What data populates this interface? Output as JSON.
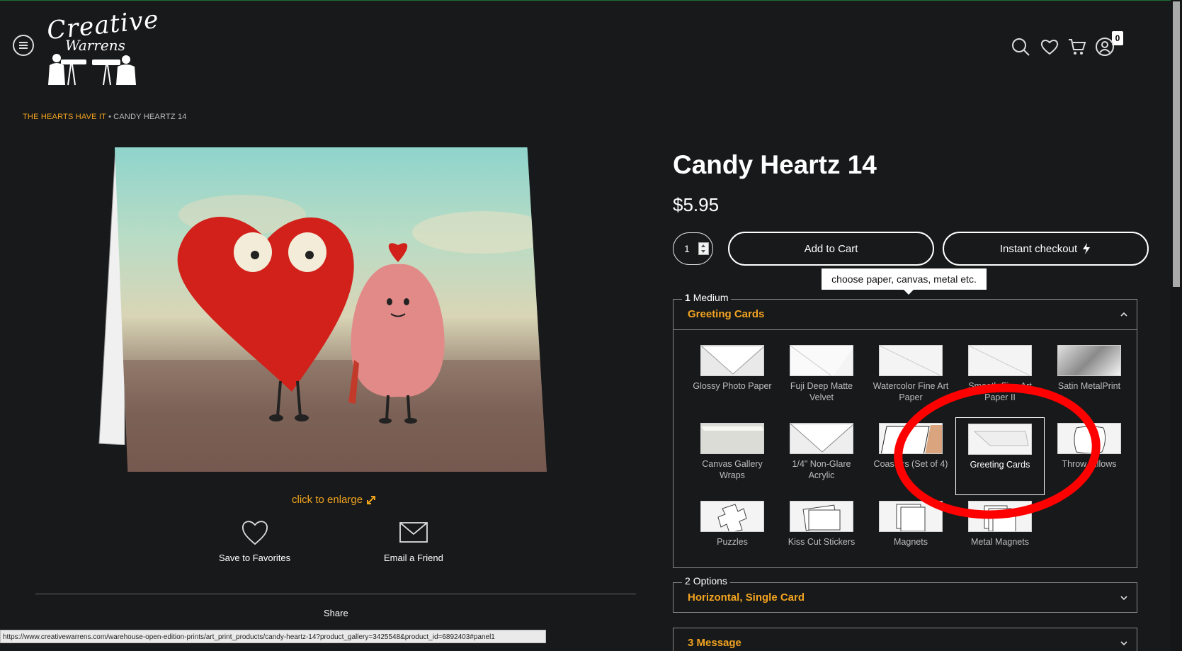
{
  "header": {
    "logo_line1": "Creative",
    "logo_line2": "Warrens",
    "cart_count": "0"
  },
  "breadcrumb": {
    "parent": "THE HEARTS HAVE IT",
    "separator": "•",
    "current": "CANDY HEARTZ 14"
  },
  "gallery": {
    "enlarge_label": "click to enlarge",
    "save_label": "Save to Favorites",
    "email_label": "Email a Friend",
    "share_label": "Share"
  },
  "product": {
    "title": "Candy Heartz 14",
    "price": "$5.95",
    "quantity": "1",
    "add_to_cart": "Add to Cart",
    "instant_checkout": "Instant checkout",
    "tooltip": "choose paper, canvas, metal etc."
  },
  "sections": {
    "medium": {
      "number": "1",
      "label": "Medium",
      "value": "Greeting Cards",
      "options": [
        {
          "label": "Glossy Photo Paper"
        },
        {
          "label": "Fuji Deep Matte Velvet"
        },
        {
          "label": "Watercolor Fine Art Paper"
        },
        {
          "label": "Smooth Fine Art Paper II"
        },
        {
          "label": "Satin MetalPrint"
        },
        {
          "label": "Canvas Gallery Wraps"
        },
        {
          "label": "1/4\" Non-Glare Acrylic"
        },
        {
          "label": "Coasters (Set of 4)"
        },
        {
          "label": "Greeting Cards"
        },
        {
          "label": "Throw Pillows"
        },
        {
          "label": "Puzzles"
        },
        {
          "label": "Kiss Cut Stickers"
        },
        {
          "label": "Magnets"
        },
        {
          "label": "Metal Magnets"
        }
      ]
    },
    "options": {
      "number": "2",
      "label": "Options",
      "value": "Horizontal, Single Card"
    },
    "message": {
      "number": "3",
      "label": "Message"
    }
  },
  "status_url": "https://www.creativewarrens.com/warehouse-open-edition-prints/art_print_products/candy-heartz-14?product_gallery=3425548&product_id=6892403#panel1",
  "colors": {
    "background": "#17191a",
    "accent": "#f2a320",
    "annotation": "#ff0000"
  }
}
